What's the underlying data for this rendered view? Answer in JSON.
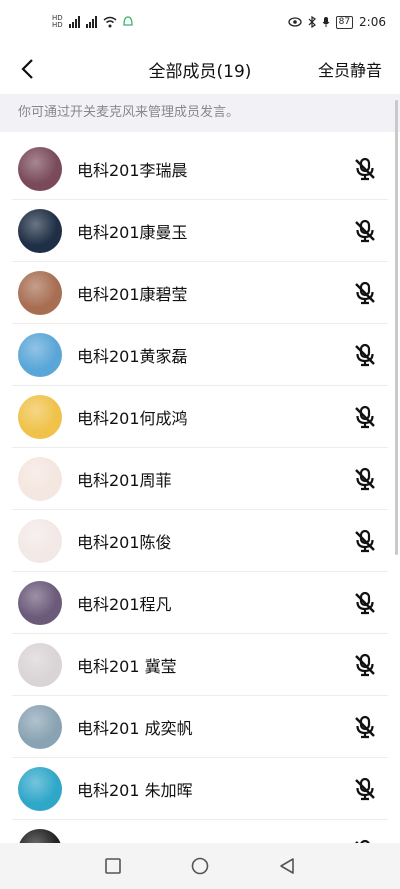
{
  "status_bar": {
    "time": "2:06",
    "battery": "87",
    "net1": "HD",
    "net2": "HD"
  },
  "header": {
    "title": "全部成员(19)",
    "mute_all_label": "全员静音"
  },
  "hint": "你可通过开关麦克风来管理成员发言。",
  "members": [
    {
      "name": "电科201李瑞晨",
      "avatar_color": "#7a4a5a"
    },
    {
      "name": "电科201康曼玉",
      "avatar_color": "#1f2f45"
    },
    {
      "name": "电科201康碧莹",
      "avatar_color": "#a86e52"
    },
    {
      "name": "电科201黄家磊",
      "avatar_color": "#5aa6d8"
    },
    {
      "name": "电科201何成鸿",
      "avatar_color": "#f0c24a"
    },
    {
      "name": "电科201周菲",
      "avatar_color": "#f4e6e0"
    },
    {
      "name": "电科201陈俊",
      "avatar_color": "#f2e9e6"
    },
    {
      "name": "电科201程凡",
      "avatar_color": "#6b5a7a"
    },
    {
      "name": "电科201 冀莹",
      "avatar_color": "#d9d4d6"
    },
    {
      "name": "电科201 成奕帆",
      "avatar_color": "#8aa3b4"
    },
    {
      "name": "电科201 朱加晖",
      "avatar_color": "#2fa7c9"
    },
    {
      "name": "",
      "avatar_color": "#222222"
    }
  ]
}
